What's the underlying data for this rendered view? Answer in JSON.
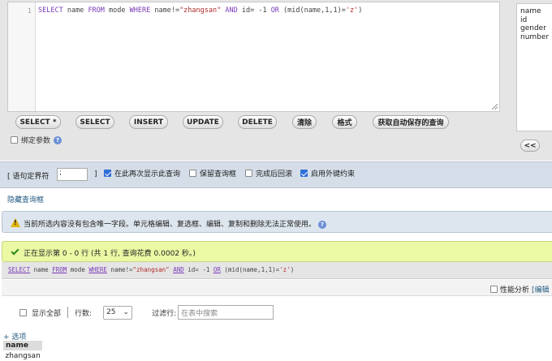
{
  "editor": {
    "line_number": "1",
    "sql_tokens": {
      "k1": "SELECT",
      "t1": " name ",
      "k2": "FROM",
      "t2": " mode ",
      "k3": "WHERE",
      "t3": " name!=",
      "s1": "\"zhangsan\"",
      "t4": " ",
      "k4": "AND",
      "t5": " id= -1 ",
      "k5": "OR",
      "t6": " (mid(name,1,1)=",
      "s2": "'z'",
      "t7": ")"
    }
  },
  "buttons": {
    "select_star": "SELECT *",
    "select": "SELECT",
    "insert": "INSERT",
    "update": "UPDATE",
    "delete": "DELETE",
    "clear": "清除",
    "format": "格式",
    "get_autosaved": "获取自动保存的查询"
  },
  "bind_params": {
    "label": "绑定参数",
    "help": "?"
  },
  "fields": [
    "name",
    "id",
    "gender",
    "number"
  ],
  "insert_field_button": "<<",
  "delimiter": {
    "label": "[ 语句定界符",
    "value": ";",
    "close": "]",
    "options": {
      "show_again": "在此再次显示此查询",
      "retain_box": "保留查询框",
      "rollback": "完成后回滚",
      "foreign_keys": "启用外键约束"
    }
  },
  "hide_query_box": "隐藏查询框",
  "notice": {
    "text": "当前所选内容没有包含唯一字段。单元格编辑、复选框、编辑、复制和删除无法正常使用。",
    "help": "?"
  },
  "success": {
    "text": "正在显示第 0 - 0 行 (共 1 行, 查询花费 0.0002 秒。)"
  },
  "executed_query": {
    "k1": "SELECT",
    "t1": " name ",
    "k2": "FROM",
    "t2": " mode ",
    "k3": "WHERE",
    "t3": " name!=",
    "s1": "\"zhangsan\"",
    "t4": " ",
    "k4": "AND",
    "t5": " id= -1 ",
    "k5": "OR",
    "t6": " (mid(name,1,1)=",
    "s2": "'z'",
    "t7": ")"
  },
  "profiling": {
    "label": "性能分析",
    "edit": "[编辑"
  },
  "navigation": {
    "show_all": "显示全部",
    "rows_label": "行数:",
    "rows_value": "25",
    "filter_label": "过滤行:",
    "filter_placeholder": "在表中搜索"
  },
  "options_link": "+ 选项",
  "table": {
    "header": "name",
    "rows": [
      "zhangsan"
    ]
  },
  "colors": {
    "accent": "#235a81",
    "success_bg": "#ebf8a4",
    "panel_bg": "#e5e5e5"
  }
}
